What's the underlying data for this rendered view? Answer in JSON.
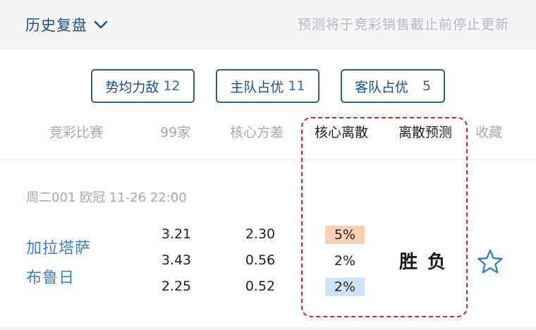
{
  "header": {
    "history_label": "历史复盘",
    "note": "预测将于竞彩销售截止前停止更新"
  },
  "filters": [
    {
      "label": "势均力敌",
      "count": "12"
    },
    {
      "label": "主队占优",
      "count": "11"
    },
    {
      "label": "客队占优",
      "count": "5"
    }
  ],
  "columns": [
    "竞彩比赛",
    "99家",
    "核心方差",
    "核心离散",
    "离散预测",
    "收藏"
  ],
  "match": {
    "meta": "周二001 欧冠 11-26 22:00",
    "home": "加拉塔萨",
    "away": "布鲁日",
    "odds99": [
      "3.21",
      "3.43",
      "2.25"
    ],
    "core_variance": [
      "2.30",
      "0.56",
      "0.52"
    ],
    "core_dispersion": [
      "5%",
      "2%",
      "2%"
    ],
    "dispersion_colors": [
      "#f8d0b3",
      "",
      "#cfe2f8"
    ],
    "prediction": [
      "胜",
      "负"
    ]
  },
  "colors": {
    "accent_blue": "#1a4f91",
    "team_link": "#3d7ec9",
    "highlight_box": "#d8222b",
    "star": "#3d7ec9"
  }
}
